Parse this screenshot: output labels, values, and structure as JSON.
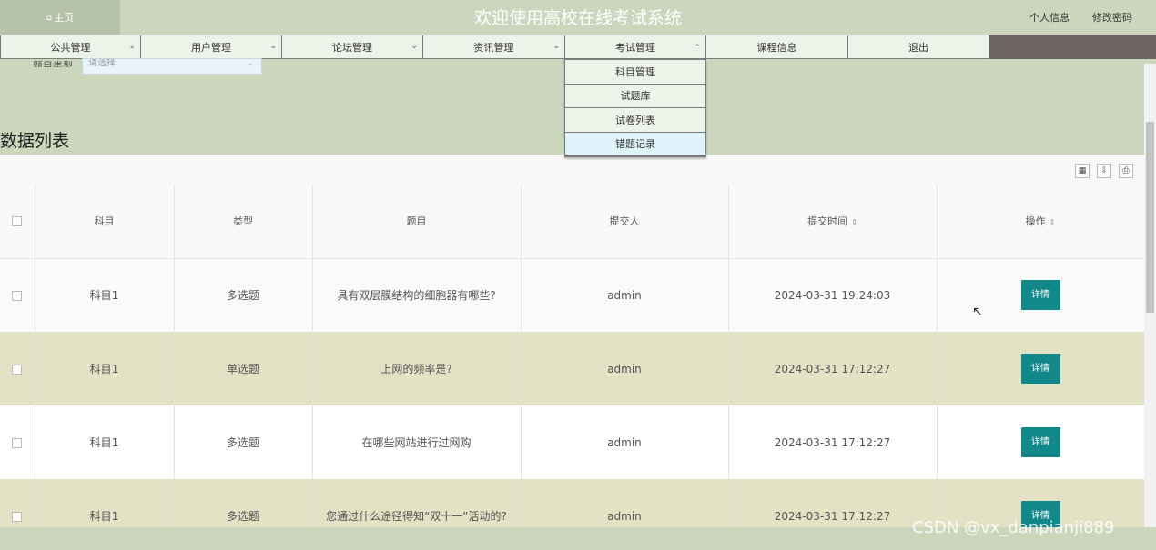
{
  "header": {
    "home_label": "主页",
    "title": "欢迎使用高校在线考试系统",
    "profile_link": "个人信息",
    "password_link": "修改密码"
  },
  "nav": {
    "items": [
      {
        "label": "公共管理",
        "has_dropdown": true
      },
      {
        "label": "用户管理",
        "has_dropdown": true
      },
      {
        "label": "论坛管理",
        "has_dropdown": true
      },
      {
        "label": "资讯管理",
        "has_dropdown": true
      },
      {
        "label": "考试管理",
        "has_dropdown": true,
        "open": true
      },
      {
        "label": "课程信息",
        "has_dropdown": false
      },
      {
        "label": "退出",
        "has_dropdown": false
      }
    ],
    "dropdown": [
      {
        "label": "科目管理"
      },
      {
        "label": "试题库"
      },
      {
        "label": "试卷列表"
      },
      {
        "label": "错题记录",
        "hover": true
      }
    ]
  },
  "search": {
    "label": "题目类型",
    "select_value": "请选择"
  },
  "list": {
    "title": "数据列表",
    "columns": [
      "科目",
      "类型",
      "题目",
      "提交人",
      "提交时间",
      "操作"
    ],
    "detail_label": "详情",
    "rows": [
      {
        "subject": "科目1",
        "type": "多选题",
        "question": "具有双层膜结构的细胞器有哪些?",
        "submitter": "admin",
        "time": "2024-03-31 19:24:03"
      },
      {
        "subject": "科目1",
        "type": "单选题",
        "question": "上网的频率是?",
        "submitter": "admin",
        "time": "2024-03-31 17:12:27"
      },
      {
        "subject": "科目1",
        "type": "多选题",
        "question": "在哪些网站进行过网购",
        "submitter": "admin",
        "time": "2024-03-31 17:12:27"
      },
      {
        "subject": "科目1",
        "type": "多选题",
        "question": "您通过什么途径得知“双十一”活动的?",
        "submitter": "admin",
        "time": "2024-03-31 17:12:27"
      }
    ]
  },
  "watermark": "CSDN @vx_danpianji889",
  "colors": {
    "background": "#cbd6bd",
    "accent_button": "#11898a",
    "navbar": "#6e6363",
    "stripe": "#e3e2c5"
  }
}
